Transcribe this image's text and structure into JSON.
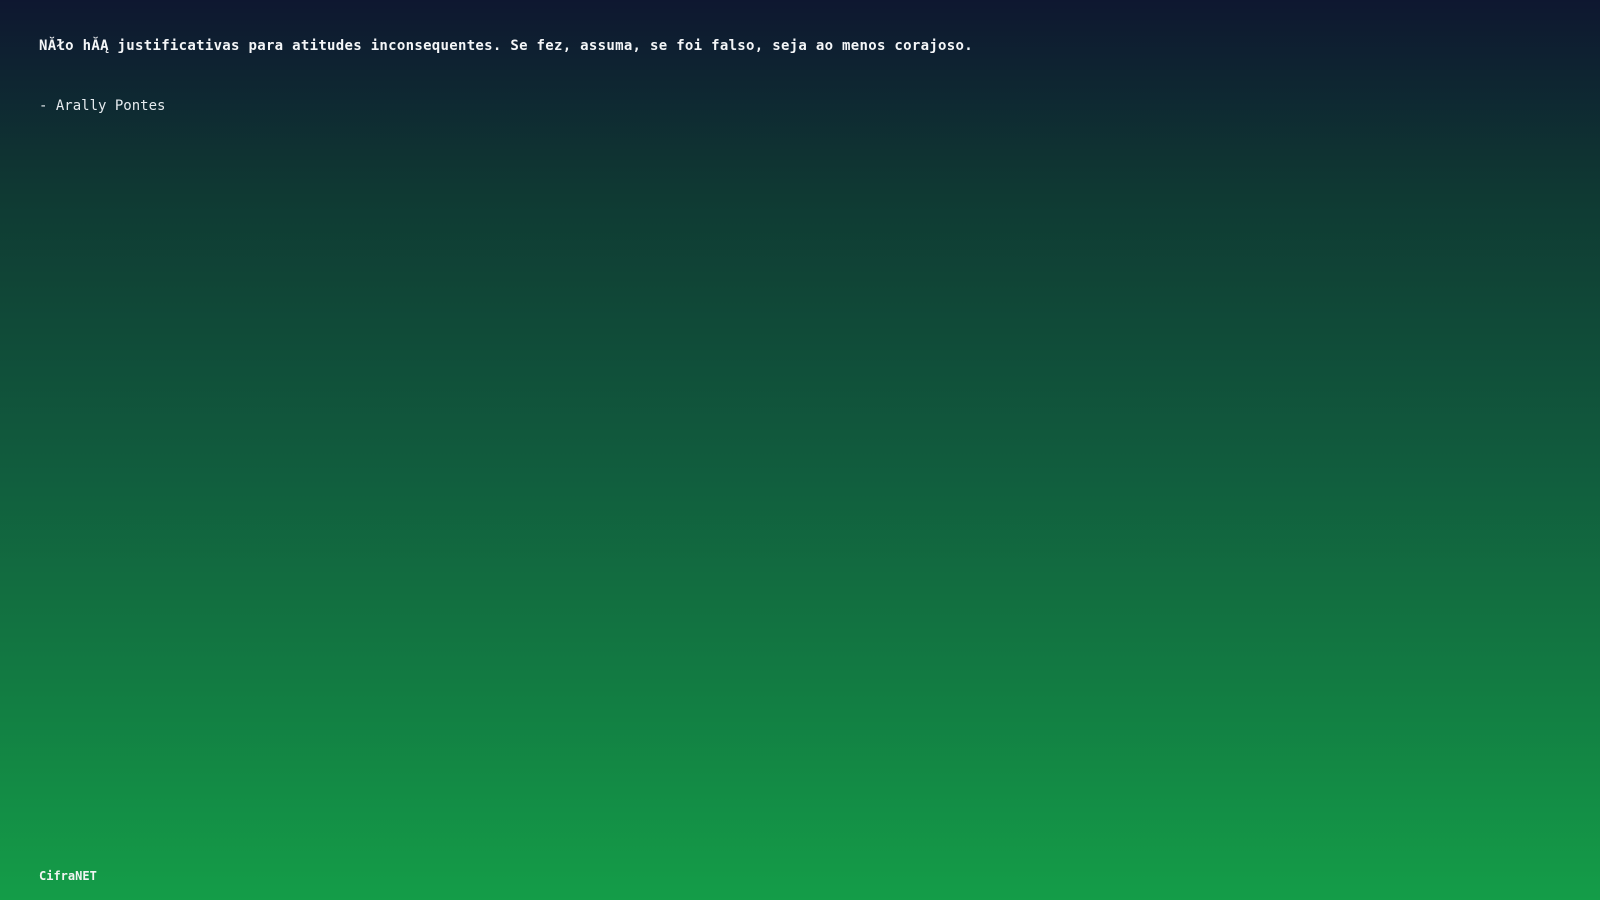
{
  "quote": {
    "text": "NĂło hĂĄ justificativas para atitudes inconsequentes. Se fez, assuma, se foi falso, seja ao menos corajoso.",
    "author": "- Arally Pontes"
  },
  "footer": {
    "brand": "CifraNET"
  },
  "colors": {
    "gradient_top": "#0e1730",
    "gradient_bottom": "#149d48",
    "text": "#ffffff"
  }
}
